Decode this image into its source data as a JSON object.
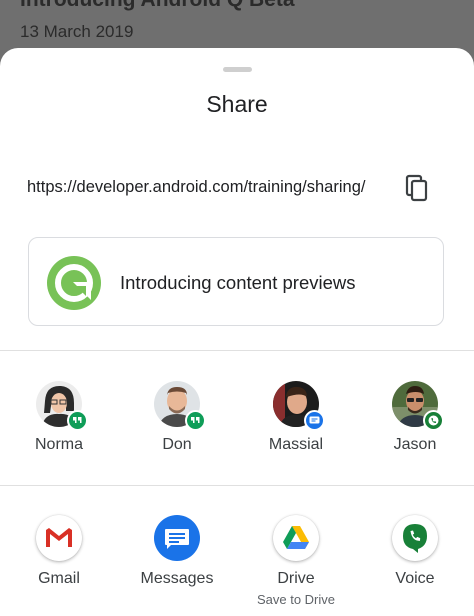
{
  "background": {
    "title": "Introducing Android Q Beta",
    "date": "13 March 2019"
  },
  "sheet": {
    "title": "Share",
    "url": "https://developer.android.com/training/sharing/",
    "copy_icon": "copy-icon",
    "preview": {
      "icon": "android-q-logo",
      "title": "Introducing content previews"
    }
  },
  "contacts": [
    {
      "name": "Norma",
      "badge": "hangouts",
      "badge_color": "#0f9d58"
    },
    {
      "name": "Don",
      "badge": "hangouts",
      "badge_color": "#0f9d58"
    },
    {
      "name": "Massial",
      "badge": "messages",
      "badge_color": "#1a73e8"
    },
    {
      "name": "Jason",
      "badge": "voice",
      "badge_color": "#188038"
    }
  ],
  "apps": [
    {
      "name": "Gmail",
      "icon": "gmail-icon"
    },
    {
      "name": "Messages",
      "icon": "messages-icon"
    },
    {
      "name": "Drive",
      "sublabel": "Save to Drive",
      "icon": "drive-icon"
    },
    {
      "name": "Voice",
      "icon": "voice-icon"
    }
  ],
  "colors": {
    "scrim": "#6f6f6f",
    "android_q_green": "#78c257",
    "messages_blue": "#1a73e8",
    "voice_green": "#188038"
  }
}
